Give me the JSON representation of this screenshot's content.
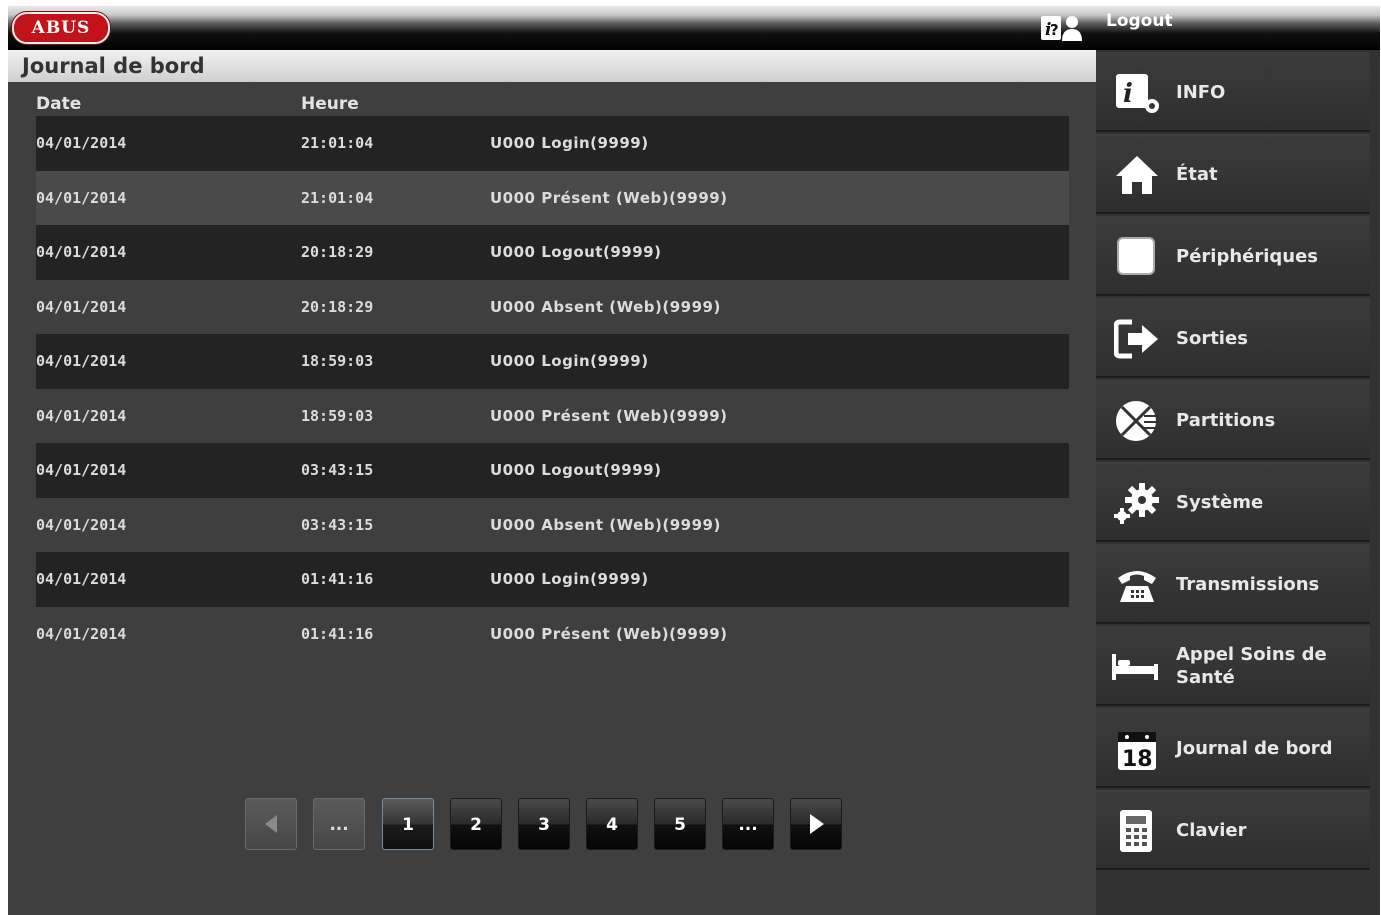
{
  "header": {
    "logo": "ABUS",
    "logout_label": "Logout"
  },
  "panel": {
    "title": "Journal de bord",
    "columns": {
      "date": "Date",
      "time": "Heure"
    }
  },
  "log_rows": [
    {
      "date": "04/01/2014",
      "time": "21:01:04",
      "message": "U000 Login(9999)"
    },
    {
      "date": "04/01/2014",
      "time": "21:01:04",
      "message": "U000 Présent (Web)(9999)"
    },
    {
      "date": "04/01/2014",
      "time": "20:18:29",
      "message": "U000 Logout(9999)"
    },
    {
      "date": "04/01/2014",
      "time": "20:18:29",
      "message": "U000 Absent (Web)(9999)"
    },
    {
      "date": "04/01/2014",
      "time": "18:59:03",
      "message": "U000 Login(9999)"
    },
    {
      "date": "04/01/2014",
      "time": "18:59:03",
      "message": "U000 Présent (Web)(9999)"
    },
    {
      "date": "04/01/2014",
      "time": "03:43:15",
      "message": "U000 Logout(9999)"
    },
    {
      "date": "04/01/2014",
      "time": "03:43:15",
      "message": "U000 Absent (Web)(9999)"
    },
    {
      "date": "04/01/2014",
      "time": "01:41:16",
      "message": "U000 Login(9999)"
    },
    {
      "date": "04/01/2014",
      "time": "01:41:16",
      "message": "U000 Présent (Web)(9999)"
    }
  ],
  "pagination": {
    "prev_icon": "prev-arrow-icon",
    "pages": [
      "...",
      "1",
      "2",
      "3",
      "4",
      "5",
      "..."
    ],
    "current_page": "1",
    "next_icon": "next-arrow-icon"
  },
  "sidebar": {
    "items": [
      {
        "label": "INFO",
        "icon": "info-icon"
      },
      {
        "label": "État",
        "icon": "home-icon"
      },
      {
        "label": "Périphériques",
        "icon": "device-icon"
      },
      {
        "label": "Sorties",
        "icon": "exit-icon"
      },
      {
        "label": "Partitions",
        "icon": "partitions-icon"
      },
      {
        "label": "Système",
        "icon": "gear-icon"
      },
      {
        "label": "Transmissions",
        "icon": "phone-icon"
      },
      {
        "label": "Appel Soins de Santé",
        "icon": "bed-icon"
      },
      {
        "label": "Journal de bord",
        "icon": "calendar-icon",
        "icon_text": "18"
      },
      {
        "label": "Clavier",
        "icon": "keypad-icon"
      }
    ]
  },
  "colors": {
    "brand_red": "#c2121a",
    "panel_bg": "#3f3f3f",
    "row_dark": "#232323",
    "row_light": "#4a4a4a"
  }
}
